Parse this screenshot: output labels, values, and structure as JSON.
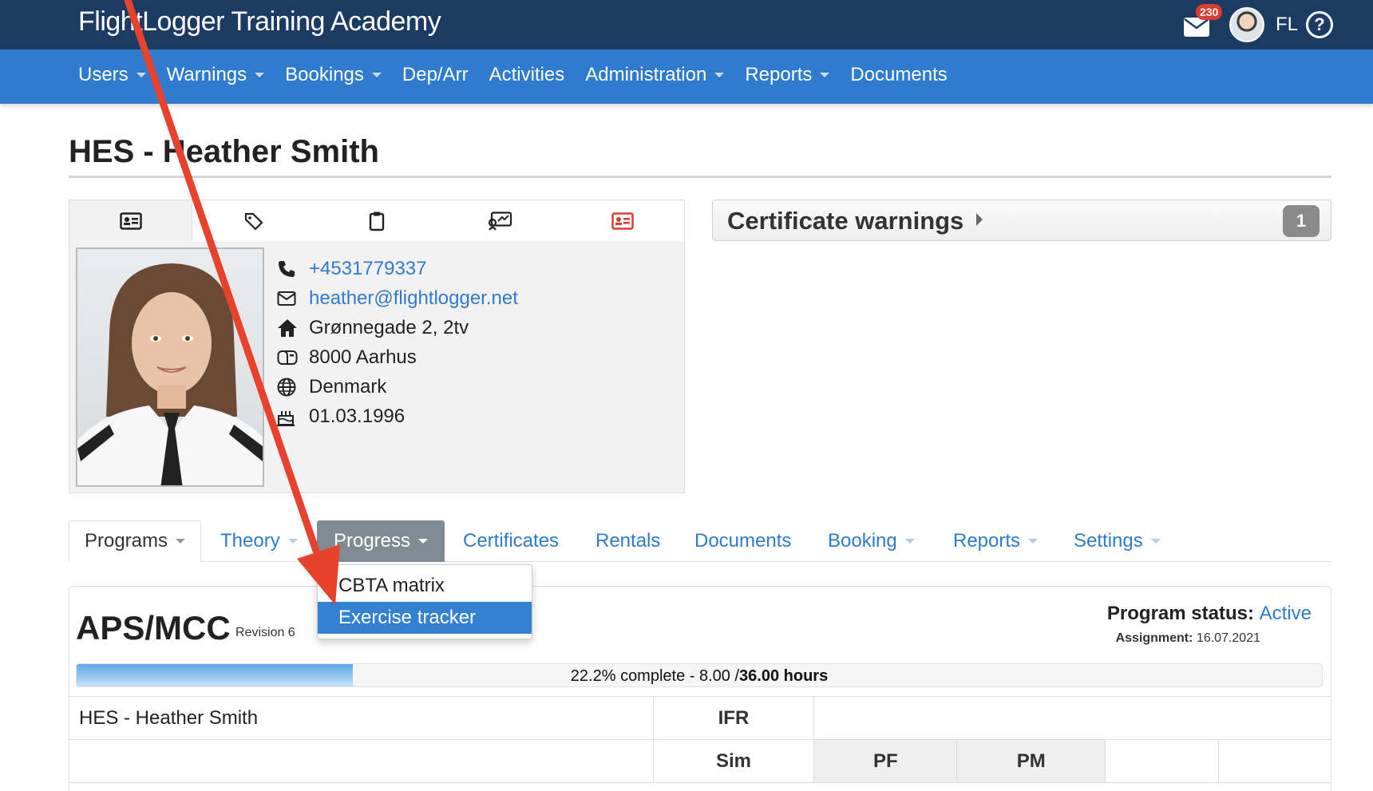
{
  "app": {
    "brand": "FlightLogger Training Academy",
    "mail_badge": "230",
    "user_initials": "FL",
    "help_label": "?"
  },
  "nav": {
    "items": [
      {
        "label": "Users",
        "caret": true
      },
      {
        "label": "Warnings",
        "caret": true
      },
      {
        "label": "Bookings",
        "caret": true
      },
      {
        "label": "Dep/Arr",
        "caret": false
      },
      {
        "label": "Activities",
        "caret": false
      },
      {
        "label": "Administration",
        "caret": true
      },
      {
        "label": "Reports",
        "caret": true
      },
      {
        "label": "Documents",
        "caret": false
      }
    ]
  },
  "page": {
    "title": "HES - Heather Smith"
  },
  "profile": {
    "tab_icons": [
      "id-card-icon",
      "tag-icon",
      "clipboard-icon",
      "certificate-icon",
      "red-id-card-icon"
    ],
    "phone": "+4531779337",
    "email": "heather@flightlogger.net",
    "address": "Grønnegade 2, 2tv",
    "city": "8000 Aarhus",
    "country": "Denmark",
    "birthdate": "01.03.1996"
  },
  "cert_warnings": {
    "title": "Certificate warnings",
    "count": "1"
  },
  "subtabs": {
    "programs": "Programs",
    "theory": "Theory",
    "progress": "Progress",
    "certificates": "Certificates",
    "rentals": "Rentals",
    "documents": "Documents",
    "booking": "Booking",
    "reports": "Reports",
    "settings": "Settings"
  },
  "progress_menu": {
    "items": [
      "CBTA matrix",
      "Exercise tracker"
    ],
    "selected": "Exercise tracker"
  },
  "program": {
    "name": "APS/MCC",
    "revision": "Revision 6",
    "status_label": "Program status:",
    "status_value": "Active",
    "assignment_label": "Assignment:",
    "assignment_value": "16.07.2021",
    "progress_pct": 0.222,
    "progress_text": "22.2% complete - 8.00 / ",
    "progress_total": "36.00 hours"
  },
  "table": {
    "student": "HES - Heather Smith",
    "col_group": "IFR",
    "col_sim": "Sim",
    "col_pf": "PF",
    "col_pm": "PM"
  },
  "colors": {
    "topbar": "#1b3b63",
    "nav": "#2f7bcf",
    "link": "#2f7bcf",
    "annotation": "#e8412c"
  }
}
